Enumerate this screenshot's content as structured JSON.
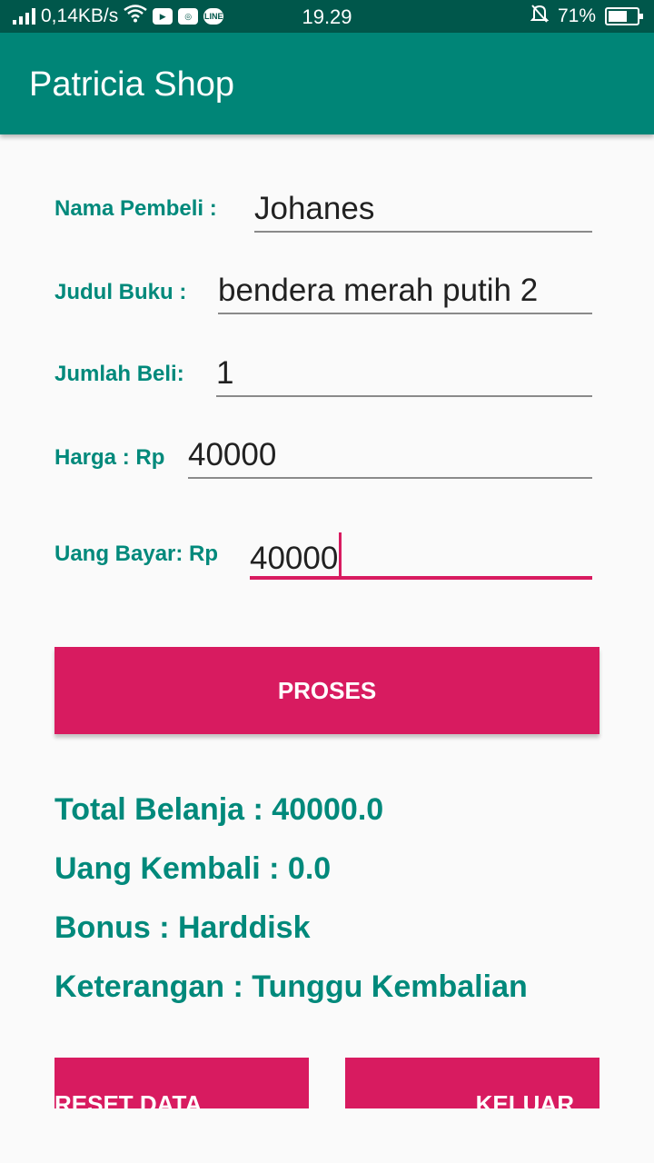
{
  "status_bar": {
    "network_speed": "0,14KB/s",
    "time": "19.29",
    "battery_percent": "71%",
    "battery_level": 0.71,
    "icons": [
      "signal-icon",
      "wifi-icon",
      "youtube-icon",
      "instagram-icon",
      "line-icon",
      "silent-icon",
      "battery-icon"
    ]
  },
  "app_bar": {
    "title": "Patricia Shop"
  },
  "form": {
    "nama_label": "Nama Pembeli :",
    "nama_value": "Johanes",
    "judul_label": "Judul Buku :",
    "judul_value": "bendera merah putih 2",
    "jumlah_label": "Jumlah Beli:",
    "jumlah_value": "1",
    "harga_label": "Harga : Rp",
    "harga_value": "40000",
    "bayar_label": "Uang Bayar: Rp",
    "bayar_value": "40000"
  },
  "buttons": {
    "proses": "PROSES",
    "reset": "RESET DATA",
    "keluar": "KELUAR"
  },
  "results": {
    "total": "Total Belanja : 40000.0",
    "kembali": "Uang Kembali : 0.0",
    "bonus": "Bonus : Harddisk",
    "keterangan": "Keterangan : Tunggu Kembalian"
  },
  "colors": {
    "primary": "#008577",
    "primary_dark": "#00574b",
    "accent": "#d81b60",
    "label_text": "#00897b"
  }
}
